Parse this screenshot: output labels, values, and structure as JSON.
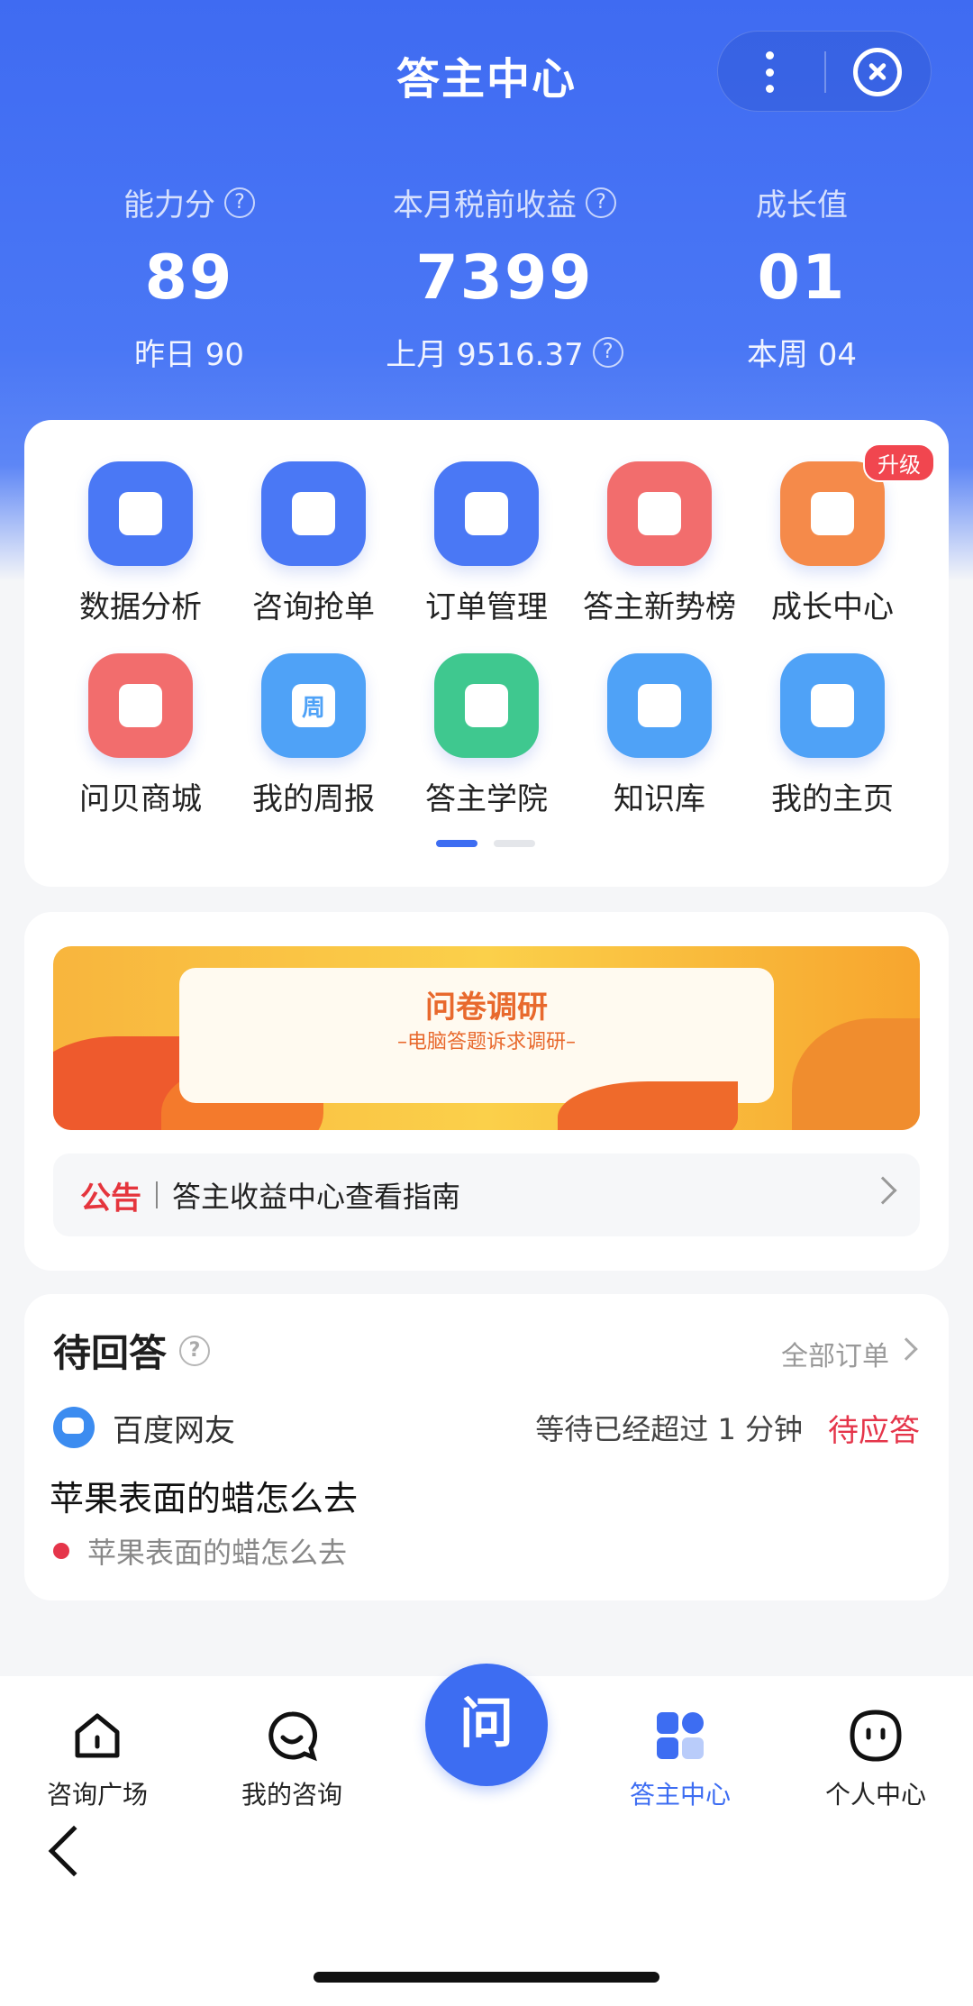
{
  "header": {
    "title": "答主中心"
  },
  "stats": [
    {
      "label": "能力分",
      "value": "89",
      "sub": "昨日 90"
    },
    {
      "label": "本月税前收益",
      "value": "7399",
      "sub": "上月 9516.37"
    },
    {
      "label": "成长值",
      "value": "01",
      "sub": "本周 04"
    }
  ],
  "grid": {
    "items": [
      {
        "label": "数据分析",
        "icon": "chart-icon",
        "color": "#4a78f5"
      },
      {
        "label": "咨询抢单",
        "icon": "lightning-icon",
        "color": "#4a78f5"
      },
      {
        "label": "订单管理",
        "icon": "document-icon",
        "color": "#4a78f5"
      },
      {
        "label": "答主新势榜",
        "icon": "trophy-icon",
        "color": "#f26d6d"
      },
      {
        "label": "成长中心",
        "icon": "crown-icon",
        "color": "#f58a4a"
      },
      {
        "label": "问贝商城",
        "icon": "shop-icon",
        "color": "#f26d6d"
      },
      {
        "label": "我的周报",
        "icon": "calendar-icon",
        "color": "#4fa2f7"
      },
      {
        "label": "答主学院",
        "icon": "play-icon",
        "color": "#3fc88f"
      },
      {
        "label": "知识库",
        "icon": "book-icon",
        "color": "#4fa2f7"
      },
      {
        "label": "我的主页",
        "icon": "star-icon",
        "color": "#4fa2f7"
      }
    ],
    "badge": "升级",
    "calendar_glyph": "周"
  },
  "banner": {
    "title": "问卷调研",
    "subtitle": "–电脑答题诉求调研–"
  },
  "notice": {
    "tag": "公告",
    "text": "答主收益中心查看指南"
  },
  "pending": {
    "title": "待回答",
    "all_orders": "全部订单",
    "user": "百度网友",
    "wait": "等待已经超过 1 分钟",
    "status": "待应答",
    "question": "苹果表面的蜡怎么去",
    "detail": "苹果表面的蜡怎么去"
  },
  "tabbar": {
    "items": [
      {
        "label": "咨询广场",
        "icon": "home-icon"
      },
      {
        "label": "我的咨询",
        "icon": "chat-icon"
      },
      {
        "label": "答主中心",
        "icon": "grid-icon",
        "active": true
      },
      {
        "label": "个人中心",
        "icon": "profile-icon"
      }
    ],
    "center": "问"
  },
  "colors": {
    "primary": "#3d6df2",
    "alert": "#e5354a"
  }
}
